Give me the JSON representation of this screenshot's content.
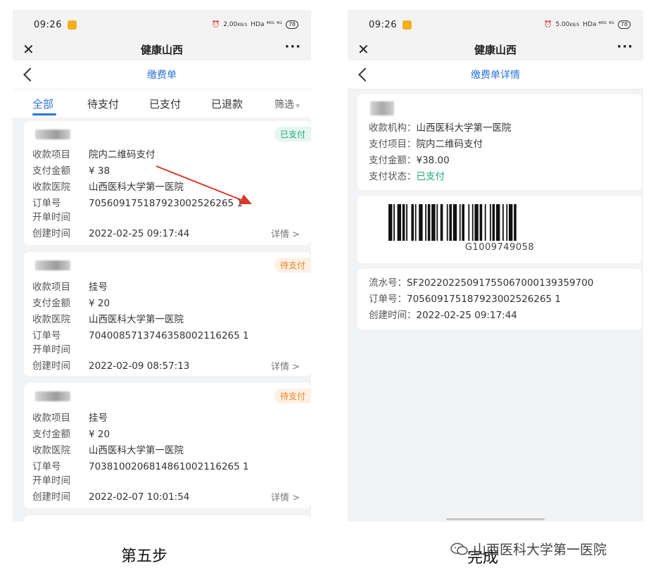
{
  "phones": {
    "left": {
      "status": {
        "time": "09:26",
        "speed": "2.00",
        "speed_unit": "KB/S",
        "network": "HDa ⁴⁶ᴳ ⁴ᴳ",
        "battery": "78"
      },
      "app_title": "健康山西",
      "page_title": "缴费单",
      "tabs": [
        "全部",
        "待支付",
        "已支付",
        "已退款",
        "筛选"
      ],
      "cards": [
        {
          "status": "已支付",
          "item_label": "收款项目",
          "item": "院内二维码支付",
          "amount_label": "支付金额",
          "amount": "¥ 38",
          "hospital_label": "收款医院",
          "hospital": "山西医科大学第一医院",
          "order_label": "订单号",
          "order": "705609175187923002526265 1",
          "open_label": "开单时间",
          "created_label": "创建时间",
          "created": "2022-02-25 09:17:44",
          "detail": "详情 >"
        },
        {
          "status": "待支付",
          "item_label": "收款项目",
          "item": "挂号",
          "amount_label": "支付金额",
          "amount": "¥ 20",
          "hospital_label": "收款医院",
          "hospital": "山西医科大学第一医院",
          "order_label": "订单号",
          "order": "7040085713746358002116265 1",
          "open_label": "开单时间",
          "created_label": "创建时间",
          "created": "2022-02-09 08:57:13",
          "detail": "详情 >"
        },
        {
          "status": "待支付",
          "item_label": "收款项目",
          "item": "挂号",
          "amount_label": "支付金额",
          "amount": "¥ 20",
          "hospital_label": "收款医院",
          "hospital": "山西医科大学第一医院",
          "order_label": "订单号",
          "order": "7038100206814861002116265 1",
          "open_label": "开单时间",
          "created_label": "创建时间",
          "created": "2022-02-07 10:01:54",
          "detail": "详情 >"
        }
      ]
    },
    "right": {
      "status": {
        "time": "09:26",
        "speed": "5.00",
        "speed_unit": "KB/S",
        "network": "HDa ⁴⁶ᴳ ⁴ᴳ",
        "battery": "78"
      },
      "app_title": "健康山西",
      "page_title": "缴费单详情",
      "info": {
        "org_label": "收款机构：",
        "org": "山西医科大学第一医院",
        "item_label": "支付项目：",
        "item": "院内二维码支付",
        "amount_label": "支付金额：",
        "amount": "¥38.00",
        "status_label": "支付状态：",
        "status": "已支付"
      },
      "barcode_text": "G1009749058",
      "meta": {
        "serial_label": "流水号：",
        "serial": "SF20220225091755067000139359700",
        "order_label": "订单号：",
        "order": "705609175187923002526265 1",
        "created_label": "创建时间：",
        "created": "2022-02-25 09:17:44"
      }
    }
  },
  "captions": {
    "left": "第五步",
    "right": "完成",
    "watermark": "山西医科大学第一医院"
  },
  "colors": {
    "accent": "#2c74d6",
    "paid": "#1fa97a",
    "unpaid": "#e6862e",
    "arrow": "#d93a2b"
  }
}
